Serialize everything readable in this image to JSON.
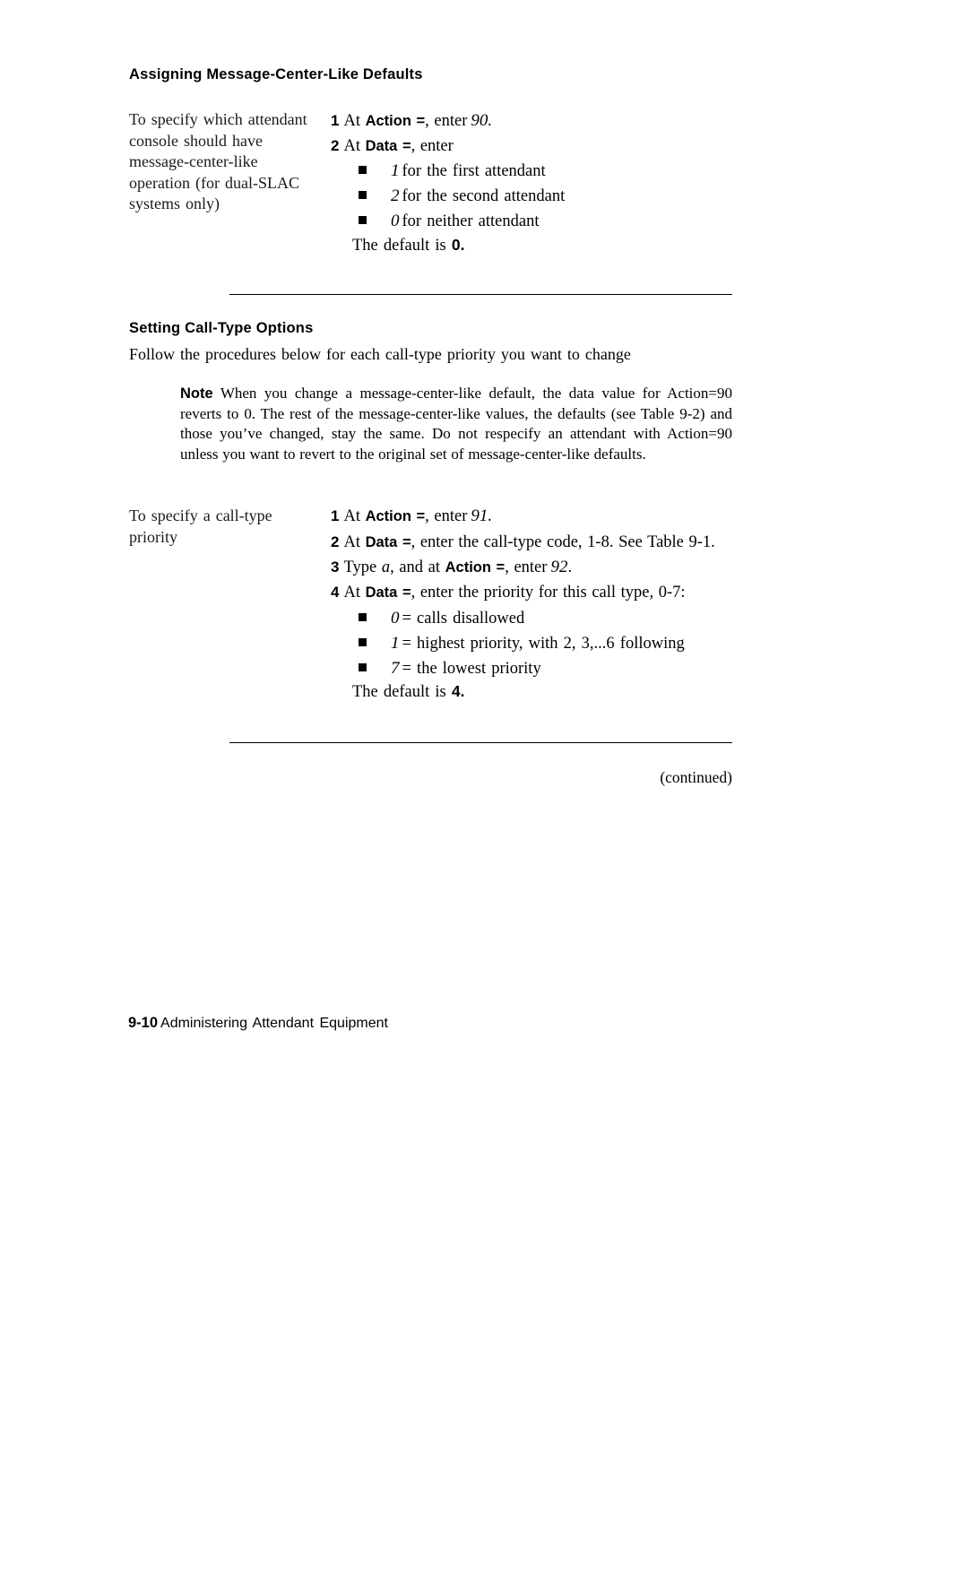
{
  "document": {
    "sections": [
      {
        "heading": "Assigning Message-Center-Like Defaults",
        "side_label": "To specify which attendant console should have message-center-like operation (for dual-SLAC systems only)",
        "steps": [
          {
            "number": "1",
            "pre": "At",
            "keyword": "Action =",
            "mid": ", enter",
            "value": "90.",
            "post": ""
          },
          {
            "number": "2",
            "pre": "At",
            "keyword": "Data =",
            "mid": ", enter",
            "value": "",
            "post": ""
          }
        ],
        "bullets": [
          {
            "value": "1",
            "text": "for the first attendant"
          },
          {
            "value": "2",
            "text": "for the second attendant"
          },
          {
            "value": "0",
            "text": "for neither attendant"
          }
        ],
        "default_text": "The default is",
        "default_value": "0."
      },
      {
        "heading": "Setting Call-Type  Options",
        "intro": "Follow the procedures below for each call-type priority you want to change",
        "note_label": "Note",
        "note_text": "When you change a message-center-like default, the data value for Action=90 reverts to 0. The rest of the message-center-like values, the defaults (see Table 9-2) and those you’ve changed, stay the same.  Do not respecify an attendant with Action=90 unless you want to revert to the original set of message-center-like defaults.",
        "side_label": "To specify a call-type priority",
        "steps": [
          {
            "number": "1",
            "pre": "At",
            "keyword": "Action =",
            "mid": ", enter",
            "value": "91.",
            "post": ""
          },
          {
            "number": "2",
            "pre": "At",
            "keyword": "Data =",
            "mid": ", enter the call-type code, 1-8. See Table 9-1.",
            "value": "",
            "post": ""
          },
          {
            "number": "3",
            "pre": "Type",
            "italic_pre": "a",
            "mid2": ", and at",
            "keyword": "Action =",
            "mid": ", enter",
            "value": "92",
            "post": "."
          },
          {
            "number": "4",
            "pre": "At",
            "keyword": "Data =",
            "mid": ", enter the priority for this call type, 0-7:",
            "value": "",
            "post": ""
          }
        ],
        "bullets": [
          {
            "value": "0",
            "text": "=  calls  disallowed"
          },
          {
            "value": "1",
            "text": "=  highest  priority,  with  2,  3,...6  following"
          },
          {
            "value": "7",
            "text": "=  the  lowest  priority"
          }
        ],
        "default_text": "The default is",
        "default_value": "4."
      }
    ],
    "continued_label": "(continued)",
    "footer": {
      "page_number": "9-10",
      "title": "Administering  Attendant  Equipment"
    }
  }
}
